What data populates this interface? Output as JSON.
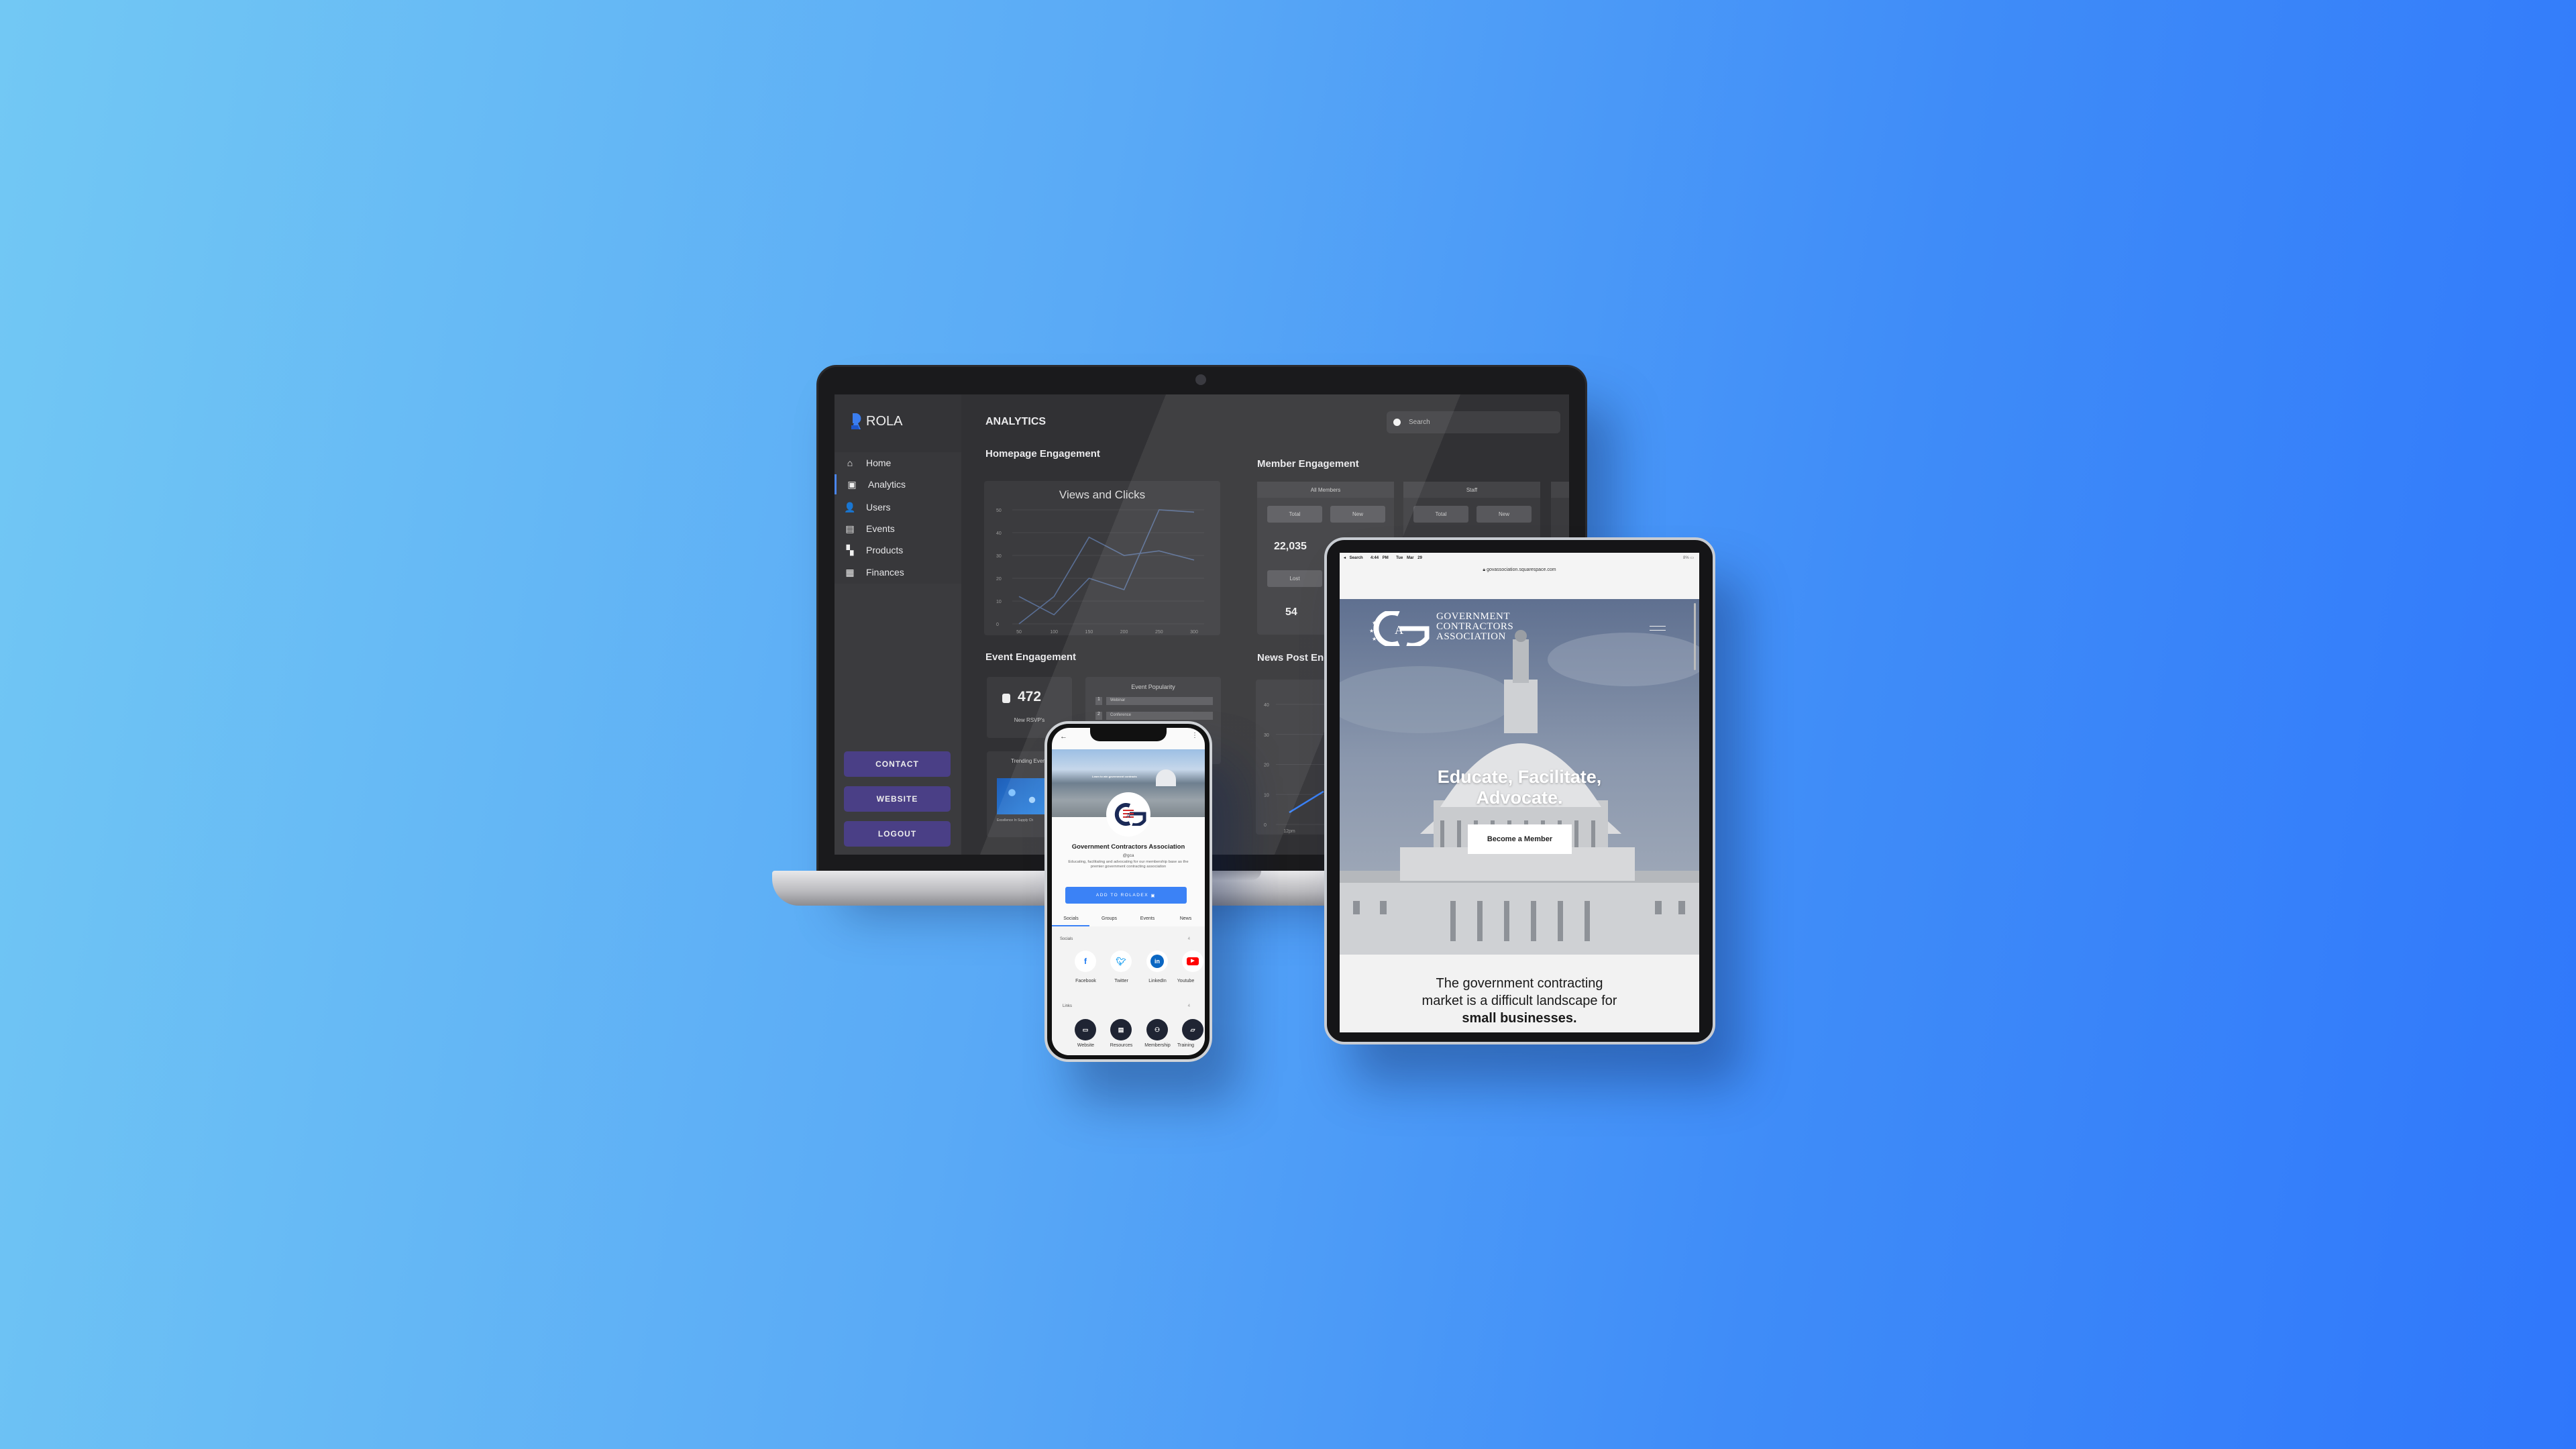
{
  "laptop": {
    "brand": "ROLA",
    "page_title": "ANALYTICS",
    "search": {
      "placeholder": "Search"
    },
    "sidebar": {
      "items": [
        {
          "label": "Home",
          "icon": "home-icon"
        },
        {
          "label": "Analytics",
          "icon": "presentation-icon",
          "active": true
        },
        {
          "label": "Users",
          "icon": "users-icon"
        },
        {
          "label": "Events",
          "icon": "calendar-icon"
        },
        {
          "label": "Products",
          "icon": "grid-icon"
        },
        {
          "label": "Finances",
          "icon": "wallet-icon"
        }
      ],
      "buttons": {
        "contact": "CONTACT",
        "website": "WEBSITE",
        "logout": "LOGOUT"
      },
      "button_color": "#4a3f86"
    },
    "homepage": {
      "heading": "Homepage Engagement"
    },
    "member": {
      "heading": "Member Engagement",
      "cards": [
        {
          "title": "All Members",
          "total": "Total",
          "new": "New",
          "value": "22,035",
          "lost": "Lost",
          "lost_value": "54"
        },
        {
          "title": "Staff",
          "total": "Total",
          "new": "New"
        }
      ]
    },
    "event": {
      "heading": "Event Engagement",
      "rsvp_value": "472",
      "rsvp_label": "New RSVP's",
      "popularity": {
        "title": "Event Popularity",
        "rows": [
          {
            "rank": "1",
            "name": "Webinar"
          },
          {
            "rank": "2",
            "name": "Conference"
          }
        ]
      },
      "trending": {
        "title": "Trending Events",
        "item": "Excellence In Supply Ch"
      }
    },
    "news": {
      "heading": "News Post Engagement"
    }
  },
  "chart_data": [
    {
      "type": "line",
      "title": "Views and Clicks",
      "x": [
        50,
        100,
        150,
        200,
        250,
        300
      ],
      "xlim": [
        50,
        300
      ],
      "ylim": [
        0,
        50
      ],
      "yticks": [
        0,
        10,
        20,
        30,
        40,
        50
      ],
      "grid": true,
      "series": [
        {
          "values": [
            12,
            4,
            20,
            15,
            50,
            49
          ],
          "color": "#5a6f95"
        },
        {
          "values": [
            0,
            12,
            38,
            30,
            32,
            28
          ],
          "color": "#5a6f95"
        }
      ]
    },
    {
      "type": "line",
      "title": "",
      "categories": [
        "12pm",
        ""
      ],
      "ylim": [
        0,
        40
      ],
      "yticks": [
        0,
        10,
        20,
        30,
        40
      ],
      "grid": true,
      "series": [
        {
          "values": [
            4,
            11
          ],
          "color": "#3b82f6"
        }
      ]
    }
  ],
  "phone": {
    "banner_text": "Learn to win government contracts",
    "org_name": "Government Contractors Association",
    "handle": "@gca",
    "description": "Educating, facilitating and advocating for our membership base as the premier government contracting association",
    "add_button": "ADD TO ROLADEX",
    "accent": "#3b82f6",
    "tabs": [
      "Socials",
      "Groups",
      "Events",
      "News"
    ],
    "socials": {
      "title": "Socials",
      "count": "4",
      "items": [
        {
          "label": "Facebook",
          "icon": "facebook-icon",
          "color": "#1877f2"
        },
        {
          "label": "Twitter",
          "icon": "twitter-icon",
          "color": "#1da1f2"
        },
        {
          "label": "LinkedIn",
          "icon": "linkedin-icon",
          "color": "#0a66c2"
        },
        {
          "label": "Youtube",
          "icon": "youtube-icon",
          "color": "#ff0000"
        }
      ]
    },
    "links": {
      "title": "Links",
      "count": "4",
      "items": [
        {
          "label": "Website",
          "icon": "laptop-icon"
        },
        {
          "label": "Resources",
          "icon": "book-icon"
        },
        {
          "label": "Membership",
          "icon": "people-icon"
        },
        {
          "label": "Training",
          "icon": "folder-icon"
        }
      ]
    }
  },
  "tablet": {
    "status": {
      "back": "◂ Search",
      "time": "4:44 PM",
      "date": "Tue Mar 29",
      "battery": "8%"
    },
    "url": "govassociation.squarespace.com",
    "logo_lines": [
      "GOVERNMENT",
      "CONTRACTORS",
      "ASSOCIATION"
    ],
    "headline_1": "Educate, Facilitate,",
    "headline_2": "Advocate.",
    "cta": "Become a Member",
    "body_1": "The government contracting",
    "body_2": "market is a difficult landscape for",
    "body_3": "small businesses."
  }
}
